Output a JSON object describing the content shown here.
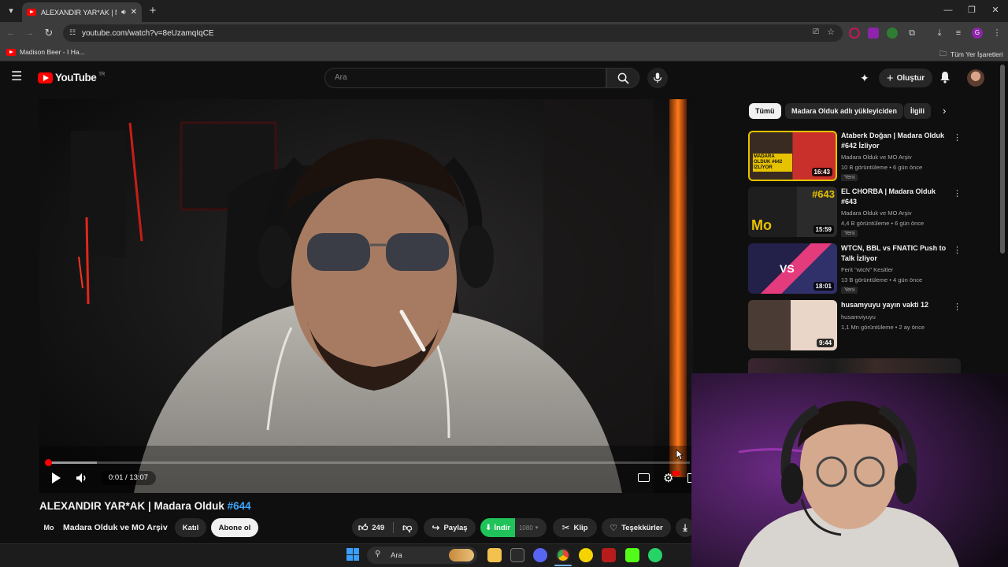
{
  "browser": {
    "tab_title": "ALEXANDIR YAR*AK | Mada",
    "url": "youtube.com/watch?v=8eUzamqIqCE",
    "bookmark": "Madison Beer - I Ha...",
    "all_bookmarks": "Tüm Yer İşaretleri",
    "profile_initial": "G"
  },
  "youtube": {
    "logo_text": "YouTube",
    "region": "TR",
    "search_placeholder": "Ara",
    "create_label": "Oluştur"
  },
  "player": {
    "time": "0:01 / 13:07",
    "progress_fraction": 0.001,
    "buffer_fraction": 0.08
  },
  "video": {
    "title": "ALEXANDIR YAR*AK | Madara Olduk",
    "hashtag": "#644",
    "channel": "Madara Olduk ve MO Arşiv",
    "channel_logo": "Mo",
    "join_label": "Katıl",
    "subscribe_label": "Abone ol",
    "likes": "249",
    "share_label": "Paylaş",
    "download_label": "İndir",
    "quality": "1080",
    "clip_label": "Klip",
    "thanks_label": "Teşekkürler"
  },
  "chips": [
    "Tümü",
    "Madara Olduk adlı yükleyiciden",
    "İlgili"
  ],
  "recommendations": [
    {
      "title": "Ataberk Doğan | Madara Olduk #642 İzliyor",
      "channel": "Madara Olduk ve MO Arşiv",
      "meta": "10 B görüntüleme • 6 gün önce",
      "badge": "Yeni",
      "duration": "16:43",
      "thumb_text": "MADARA OLDUK #642 İZLİYOR",
      "colors": [
        "#3a2b22",
        "#c9302c"
      ]
    },
    {
      "title": "EL CHORBA | Madara Olduk #643",
      "channel": "Madara Olduk ve MO Arşiv",
      "meta": "4,4 B görüntüleme • 6 gün önce",
      "badge": "Yeni",
      "duration": "15:59",
      "thumb_text": "#643",
      "colors": [
        "#1e1e1e",
        "#e6c200"
      ]
    },
    {
      "title": "WTCN, BBL vs FNATIC Push to Talk İzliyor",
      "channel": "Ferit \"wtcN\" Kesitler",
      "meta": "13 B görüntüleme • 4 gün önce",
      "badge": "Yeni",
      "duration": "18:01",
      "thumb_text": "VS",
      "colors": [
        "#23204a",
        "#e33b7c"
      ]
    },
    {
      "title": "husamyuyu yayın vakti 12",
      "channel": "husamviyuyu",
      "meta": "1,1 Mn görüntüleme • 2 ay önce",
      "badge": "",
      "duration": "9:44",
      "thumb_text": "",
      "colors": [
        "#4a3c35",
        "#e9d6c9"
      ]
    }
  ],
  "taskbar": {
    "search": "Ara"
  }
}
